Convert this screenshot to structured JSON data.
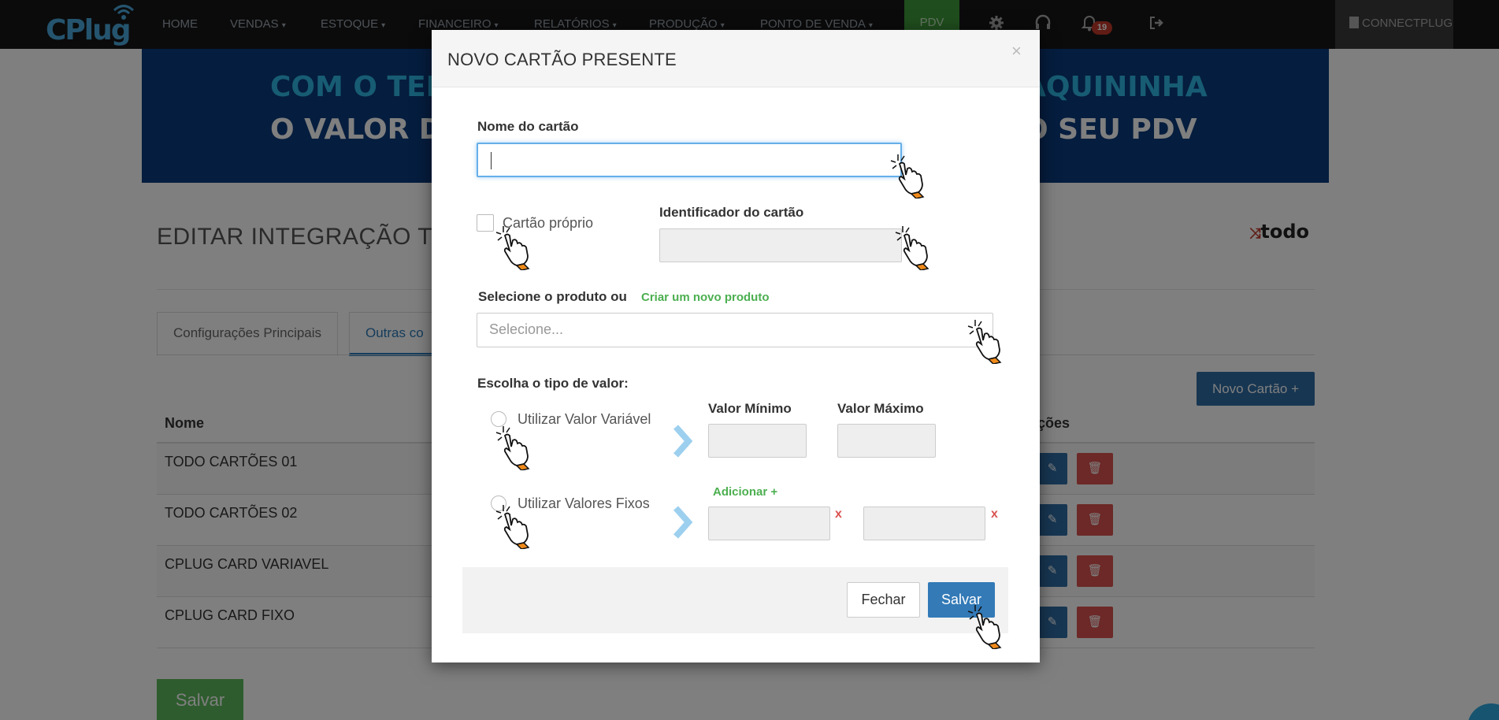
{
  "navbar": {
    "logo_text": "CPlug",
    "items": [
      {
        "label": "HOME",
        "has_caret": false
      },
      {
        "label": "VENDAS",
        "has_caret": true
      },
      {
        "label": "ESTOQUE",
        "has_caret": true
      },
      {
        "label": "FINANCEIRO",
        "has_caret": true
      },
      {
        "label": "RELATÓRIOS",
        "has_caret": true
      },
      {
        "label": "PRODUÇÃO",
        "has_caret": true
      },
      {
        "label": "PONTO DE VENDA",
        "has_caret": true
      }
    ],
    "pdv_label": "PDV",
    "notification_count": "19",
    "account_label": "CONNECTPLUG",
    "icons": [
      "gear-icon",
      "headset-icon",
      "bell-icon",
      "logout-icon",
      "building-icon"
    ],
    "caret_glyph": "▾"
  },
  "banner": {
    "line1_left": "COM O TEF",
    "line2_left": "O VALOR D",
    "line1_right": "AQUININHA",
    "line2_right": "O SEU PDV"
  },
  "page": {
    "title": "EDITAR INTEGRAÇÃO TO",
    "partner_logo": "todo",
    "tabs": [
      {
        "label": "Configurações Principais",
        "active": false
      },
      {
        "label": "Outras co",
        "active": true
      }
    ],
    "new_card_button": "Novo Cartão +",
    "table": {
      "col_name": "Nome",
      "col_actions": "ções",
      "rows": [
        "TODO CARTÕES 01",
        "TODO CARTÕES 02",
        "CPLUG CARD VARIAVEL",
        "CPLUG CARD FIXO"
      ]
    },
    "save_button": "Salvar"
  },
  "modal": {
    "title": "NOVO CARTÃO PRESENTE",
    "close_glyph": "×",
    "card_name_label": "Nome do cartão",
    "card_name_value": "",
    "own_card_label": "Cartão próprio",
    "own_card_checked": false,
    "card_id_label": "Identificador do cartão",
    "product_label": "Selecione o produto ou",
    "create_product_link": "Criar um novo produto",
    "product_placeholder": "Selecione...",
    "value_type_label": "Escolha o tipo de valor:",
    "variable_option": "Utilizar Valor Variável",
    "fixed_option": "Utilizar Valores Fixos",
    "min_label": "Valor Mínimo",
    "max_label": "Valor Máximo",
    "add_link": "Adicionar +",
    "remove_glyph": "x",
    "close_button": "Fechar",
    "save_button": "Salvar"
  },
  "colors": {
    "accent": "#337ab7",
    "success": "#5cb85c",
    "danger": "#d9534f",
    "link_green": "#4caf50",
    "navbar": "#161616",
    "banner": "#0b3a7c"
  }
}
